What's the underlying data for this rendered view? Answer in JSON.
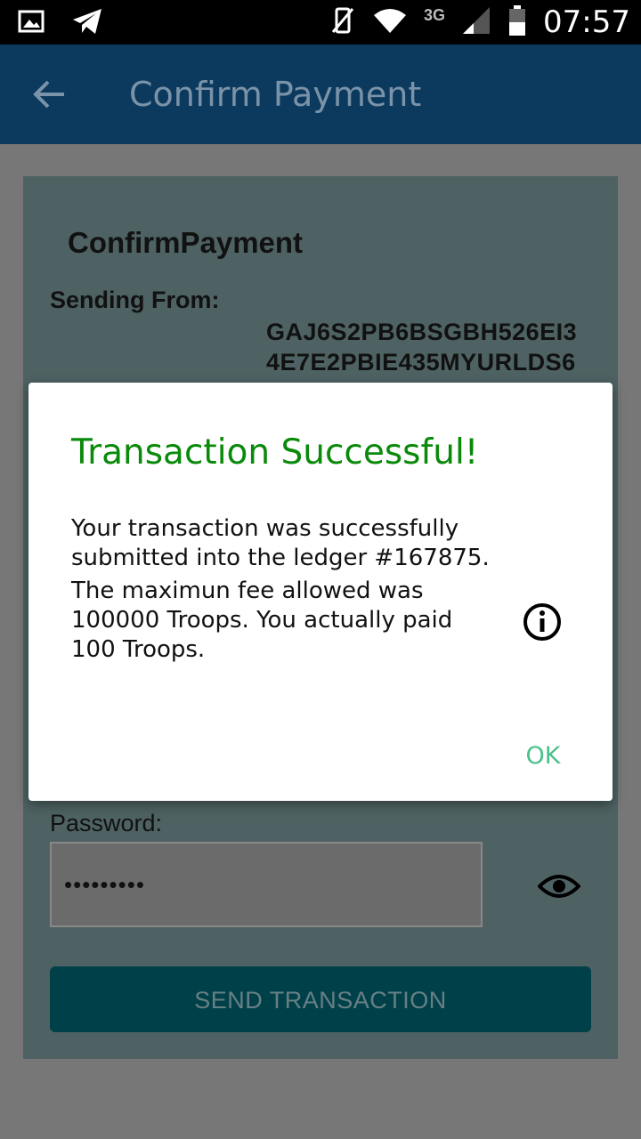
{
  "status_bar": {
    "time": "07:57",
    "network": "3G",
    "left_icons": [
      "image-icon",
      "telegram-icon"
    ],
    "right_icons": [
      "vibrate-off-icon",
      "wifi-icon",
      "signal-icon",
      "battery-icon"
    ]
  },
  "app_bar": {
    "title": "Confirm Payment",
    "back_icon": "arrow-left-icon",
    "color": "#0b3a5e"
  },
  "form": {
    "card_title": "ConfirmPayment",
    "sending_from_label": "Sending From:",
    "address_line1": "GAJ6S2PB6BSGBH526EI3",
    "address_line2": "4E7E2PBIE435MYURLDS6",
    "password_label": "Password:",
    "password_value": "•••••••••",
    "send_button": "SEND TRANSACTION"
  },
  "dialog": {
    "title": "Transaction Successful!",
    "message_p1": "Your transaction was successfully submitted into the ledger #167875.",
    "message_p2": "The maximun fee allowed was 100000 Troops. You actually paid 100 Troops.",
    "ok_label": "OK",
    "title_color": "#0a8a0a",
    "ok_color": "#4cc08a"
  }
}
